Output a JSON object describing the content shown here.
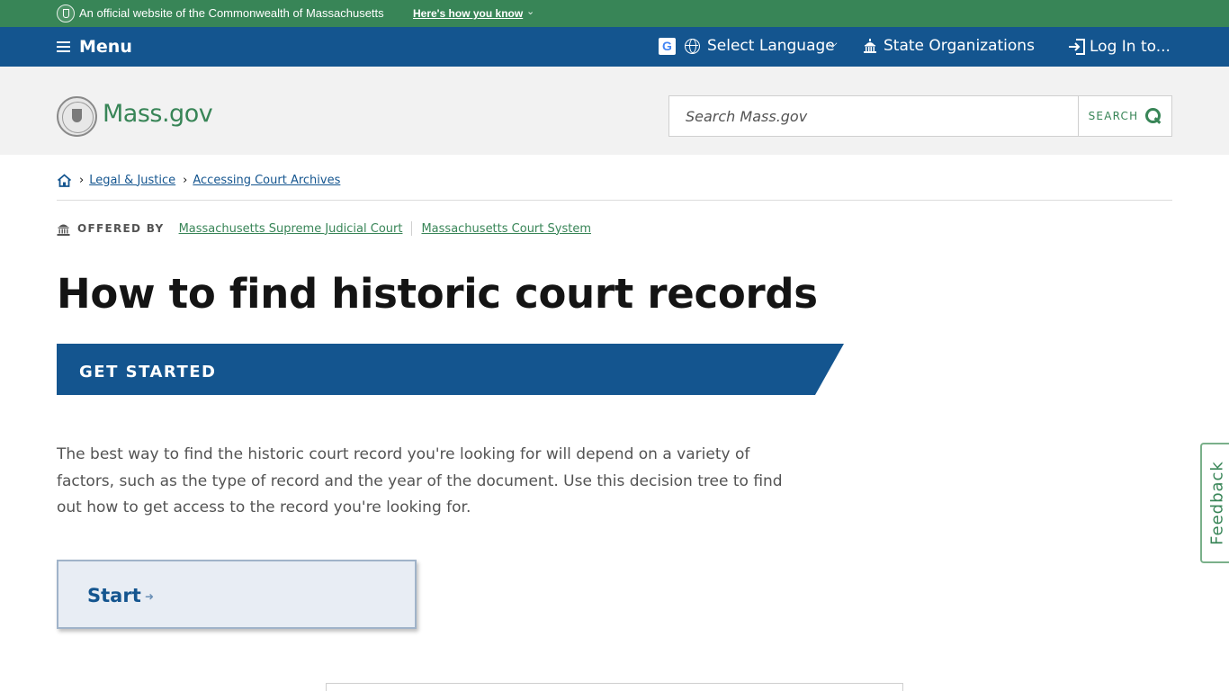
{
  "official_banner": {
    "text": "An official website of the Commonwealth of Massachusetts",
    "link": "Here's how you know"
  },
  "utility_nav": {
    "menu": "Menu",
    "language": "Select Language",
    "organizations": "State Organizations",
    "login": "Log In to..."
  },
  "header": {
    "logo_text": "Mass.gov",
    "search_placeholder": "Search Mass.gov",
    "search_button": "SEARCH"
  },
  "breadcrumb": {
    "items": [
      "Legal & Justice",
      "Accessing Court Archives"
    ]
  },
  "offered_by": {
    "label": "OFFERED BY",
    "orgs": [
      "Massachusetts Supreme Judicial Court",
      "Massachusetts Court System"
    ]
  },
  "page": {
    "title": "How to find historic court records",
    "section_heading": "GET STARTED",
    "intro": "The best way to find the historic court record you're looking for will depend on a variety of factors, such as the type of record and the year of the document. Use this decision tree to find out how to get access to the record you're looking for.",
    "start_button": "Start"
  },
  "feedback_tab": "Feedback",
  "colors": {
    "brand_green": "#388557",
    "brand_blue": "#14558f",
    "header_bg": "#f2f2f2"
  }
}
